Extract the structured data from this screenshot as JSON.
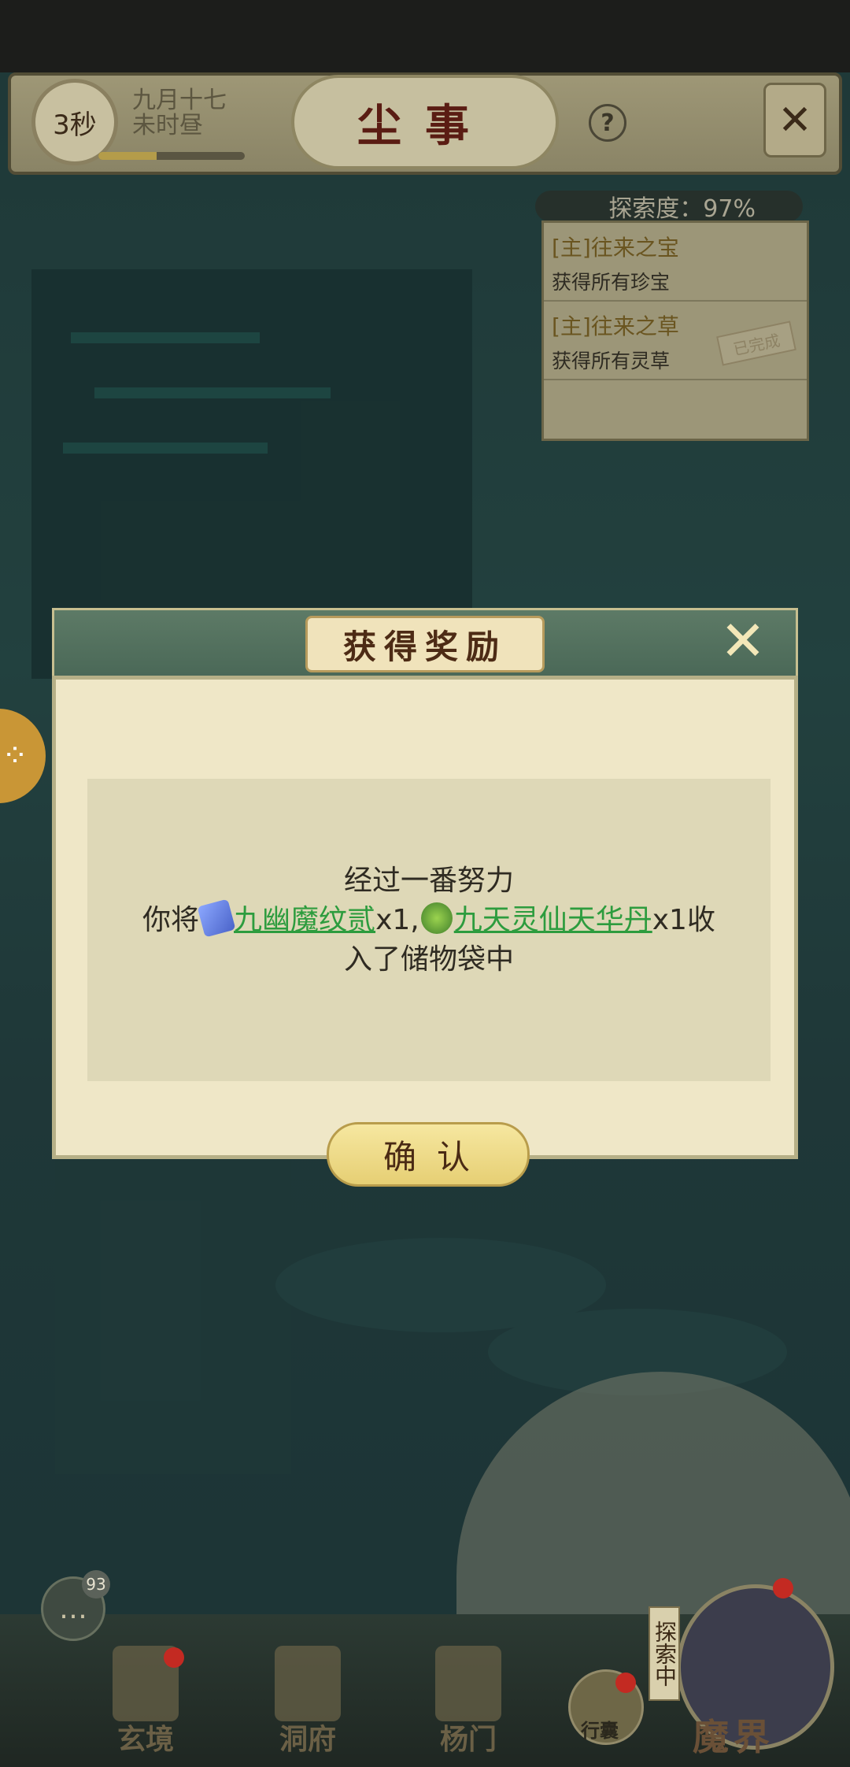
{
  "header": {
    "timer_label": "3秒",
    "date_line1": "九月十七",
    "date_line2": "未时昼",
    "day_progress": 0.4,
    "title": "尘事",
    "help_label": "?",
    "exit_icon": "crossed-swords-icon"
  },
  "quest_panel": {
    "explore_label": "探索度：97%",
    "quests": [
      {
        "title": "[主]往来之宝",
        "desc": "获得所有珍宝",
        "status": ""
      },
      {
        "title": "[主]往来之草",
        "desc": "获得所有灵草",
        "status": "已完成"
      }
    ]
  },
  "modal": {
    "title": "获得奖励",
    "line1": "经过一番努力",
    "line2_prefix": "你将",
    "item1_name": "九幽魔纹贰",
    "item1_qty": "x1,",
    "item2_name": "九天灵仙天华丹",
    "item2_qty": "x1收",
    "line3": "入了储物袋中",
    "confirm_label": "确认",
    "link_color": "#2d9c3e"
  },
  "chat": {
    "badge": "93"
  },
  "nav": {
    "items": [
      {
        "label": "玄境"
      },
      {
        "label": "洞府"
      },
      {
        "label": "杨门"
      }
    ],
    "bag_label": "行囊",
    "realm_label": "魔界",
    "explore_tag": "探索中"
  }
}
